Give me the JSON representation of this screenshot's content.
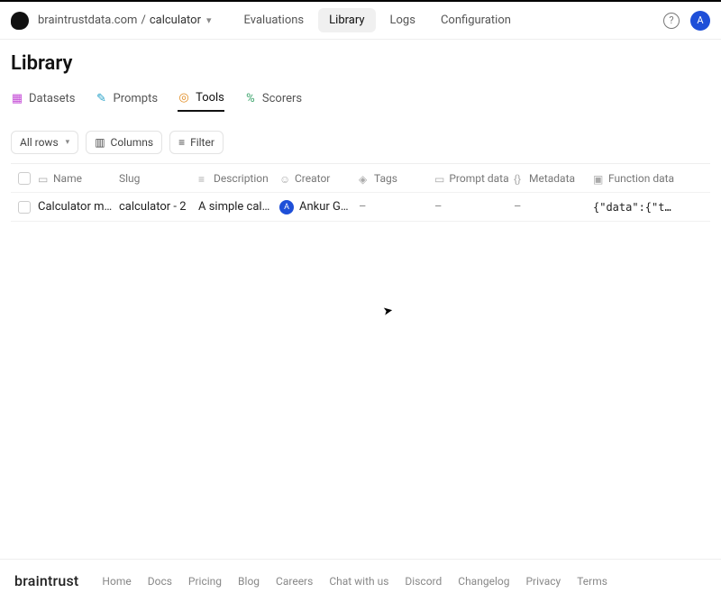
{
  "breadcrumb": {
    "org": "braintrustdata.com",
    "sep": "/",
    "project": "calculator"
  },
  "topnav": {
    "evaluations": "Evaluations",
    "library": "Library",
    "logs": "Logs",
    "configuration": "Configuration"
  },
  "avatar_initial": "A",
  "page_title": "Library",
  "subtabs": {
    "datasets": "Datasets",
    "prompts": "Prompts",
    "tools": "Tools",
    "scorers": "Scorers"
  },
  "toolbar": {
    "allrows": "All rows",
    "columns": "Columns",
    "filter": "Filter"
  },
  "columns": {
    "name": "Name",
    "slug": "Slug",
    "description": "Description",
    "creator": "Creator",
    "tags": "Tags",
    "prompt_data": "Prompt data",
    "metadata": "Metadata",
    "function_data": "Function data"
  },
  "rows": [
    {
      "name": "Calculator m…",
      "slug": "calculator - 2",
      "description": "A simple cal…",
      "creator_initial": "A",
      "creator": "Ankur G…",
      "tags": "–",
      "prompt_data": "–",
      "metadata": "–",
      "function_data": "{\"data\":{\"t…"
    }
  ],
  "footer": {
    "brand": "braintrust",
    "links": [
      "Home",
      "Docs",
      "Pricing",
      "Blog",
      "Careers",
      "Chat with us",
      "Discord",
      "Changelog",
      "Privacy",
      "Terms"
    ]
  }
}
